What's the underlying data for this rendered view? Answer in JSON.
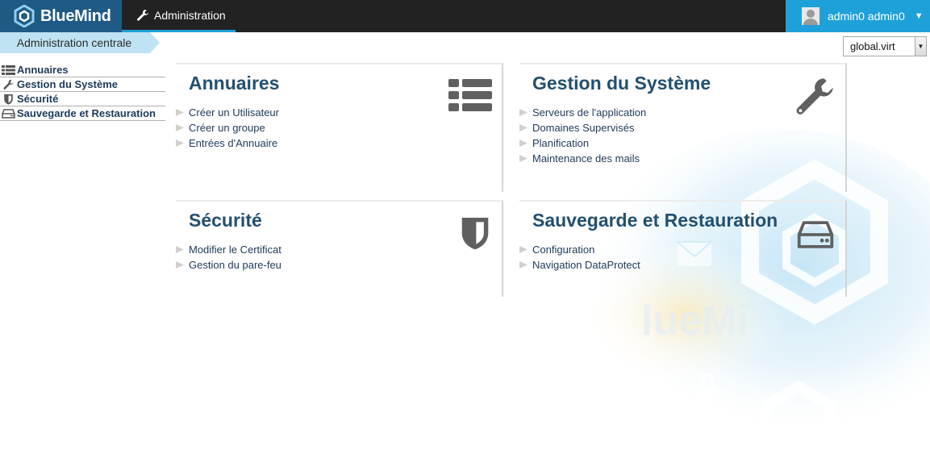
{
  "header": {
    "brand": "BlueMind",
    "active_tab": "Administration",
    "user_name": "admin0 admin0",
    "user_menu_caret": "▼"
  },
  "breadcrumb": "Administration centrale",
  "domain_select": {
    "selected": "global.virt"
  },
  "sidebar": {
    "items": [
      {
        "label": "Annuaires",
        "icon": "list-icon"
      },
      {
        "label": "Gestion du Système",
        "icon": "wrench-icon"
      },
      {
        "label": "Sécurité",
        "icon": "shield-icon"
      },
      {
        "label": "Sauvegarde et Restauration",
        "icon": "hard-drive-icon"
      }
    ]
  },
  "panels": {
    "annuaires": {
      "title": "Annuaires",
      "icon": "list-icon",
      "links": [
        "Créer un Utilisateur",
        "Créer un groupe",
        "Entrées d'Annuaire"
      ]
    },
    "systeme": {
      "title": "Gestion du Système",
      "icon": "wrench-icon",
      "links": [
        "Serveurs de l'application",
        "Domaines Supervisés",
        "Planification",
        "Maintenance des mails"
      ]
    },
    "securite": {
      "title": "Sécurité",
      "icon": "shield-icon",
      "links": [
        "Modifier le Certificat",
        "Gestion du pare-feu"
      ]
    },
    "sauvegarde": {
      "title": "Sauvegarde et Restauration",
      "icon": "hard-drive-icon",
      "links": [
        "Configuration",
        "Navigation DataProtect"
      ]
    }
  },
  "colors": {
    "brand_dark": "#1f5a85",
    "accent": "#1ea1d9",
    "title": "#23506f",
    "nav_text": "#1d3a5a"
  }
}
